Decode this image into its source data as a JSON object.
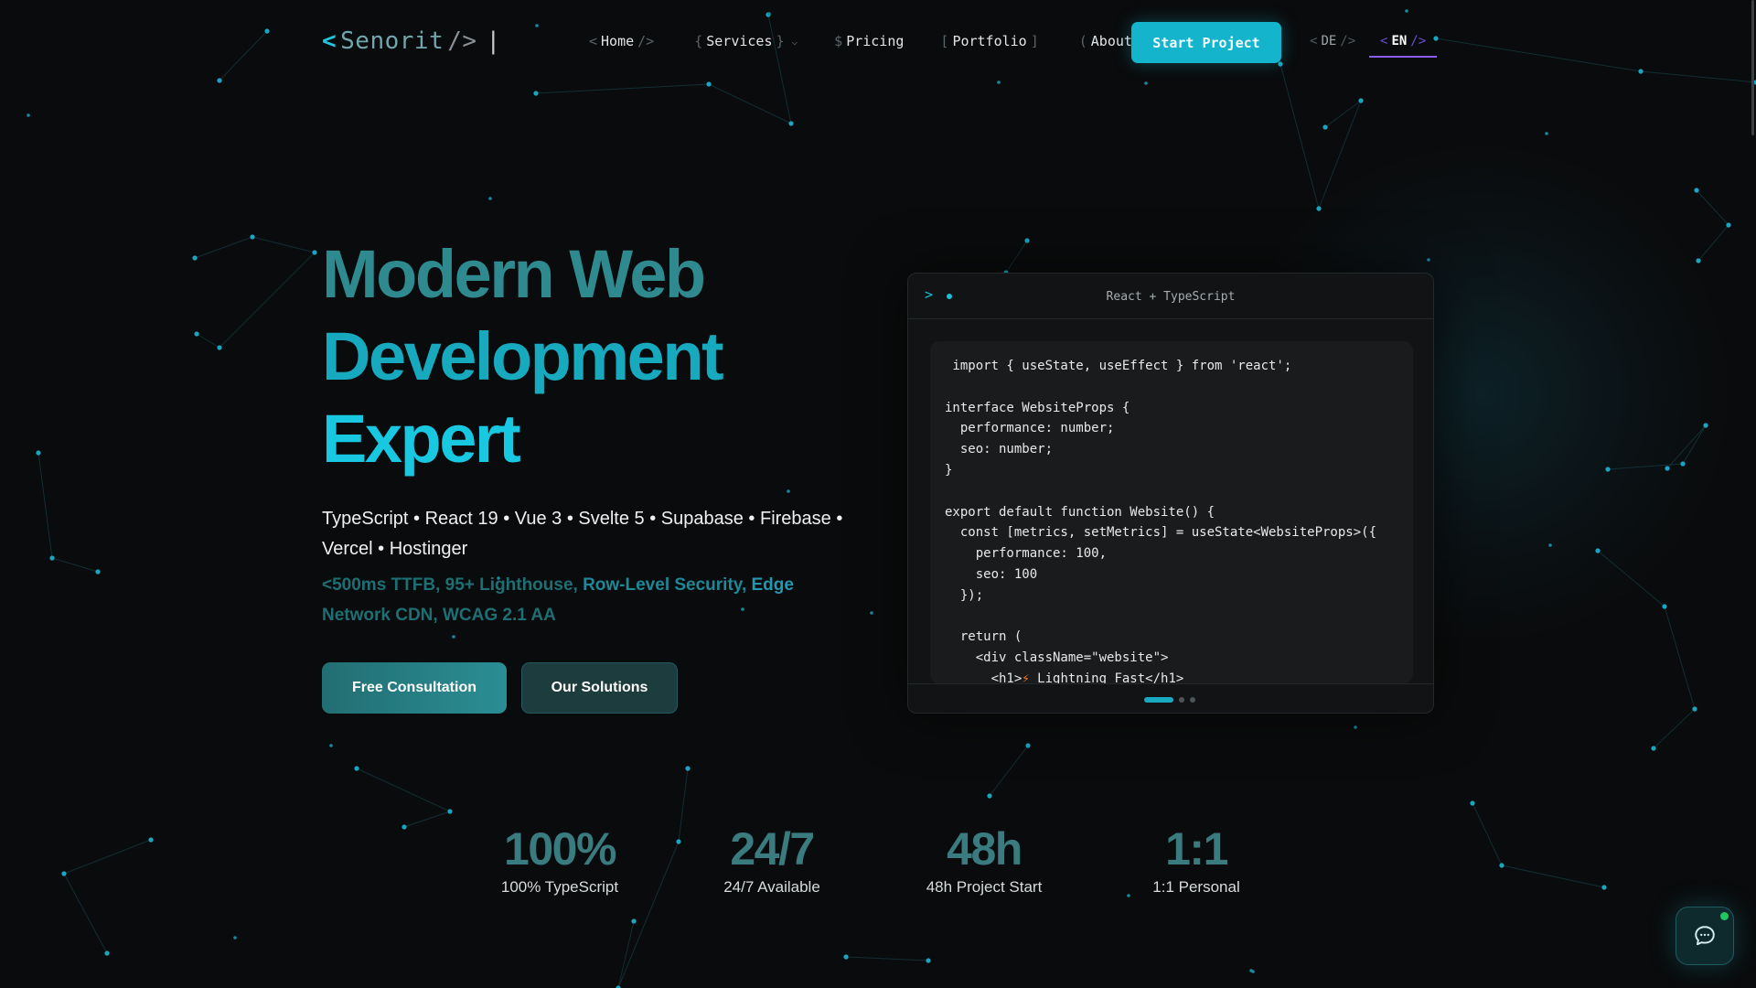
{
  "brand": {
    "lt": "<",
    "name": "Senorit",
    "slash": "/>",
    "cursor": "|"
  },
  "nav": {
    "home": "Home",
    "services": "Services",
    "pricing": "Pricing",
    "portfolio": "Portfolio",
    "about": "About",
    "start_project": "Start Project",
    "lang_de": "DE",
    "lang_en": "EN"
  },
  "hero": {
    "title_line1": "Modern Web",
    "title_line2": "Development",
    "title_line3": "Expert",
    "tech_stack": "TypeScript • React 19 • Vue 3 • Svelte 5 • Supabase • Firebase • Vercel • Hostinger",
    "perf_a": "<500ms TTFB, 95+ Lighthouse,",
    "perf_b": " Row-Level Security,",
    "perf_c": " Edge",
    "perf_d": "Network CDN, WCAG 2.1 AA",
    "cta_primary": "Free Consultation",
    "cta_secondary": "Our Solutions"
  },
  "code_window": {
    "prompt": ">",
    "title": "React + TypeScript",
    "lines": [
      " import { useState, useEffect } from 'react';",
      "",
      "interface WebsiteProps {",
      "  performance: number;",
      "  seo: number;",
      "}",
      "",
      "export default function Website() {",
      "  const [metrics, setMetrics] = useState<WebsiteProps>({",
      "    performance: 100,",
      "    seo: 100",
      "  });",
      "",
      "  return (",
      "    <div className=\"website\">",
      "      <h1>⚡ Lightning Fast</h1>"
    ],
    "slides_total": 3,
    "slide_active": 1
  },
  "stats": [
    {
      "value": "100%",
      "label": "100% TypeScript"
    },
    {
      "value": "24/7",
      "label": "24/7 Available"
    },
    {
      "value": "48h",
      "label": "48h Project Start"
    },
    {
      "value": "1:1",
      "label": "1:1 Personal"
    }
  ],
  "colors": {
    "accent": "#18c7e0",
    "accent_dark": "#226e72",
    "lang_underline": "#8b5cf6",
    "online": "#22c55e"
  },
  "icons": {
    "chat": "chat-bubble-icon",
    "chevron": "chevron-down-icon"
  }
}
